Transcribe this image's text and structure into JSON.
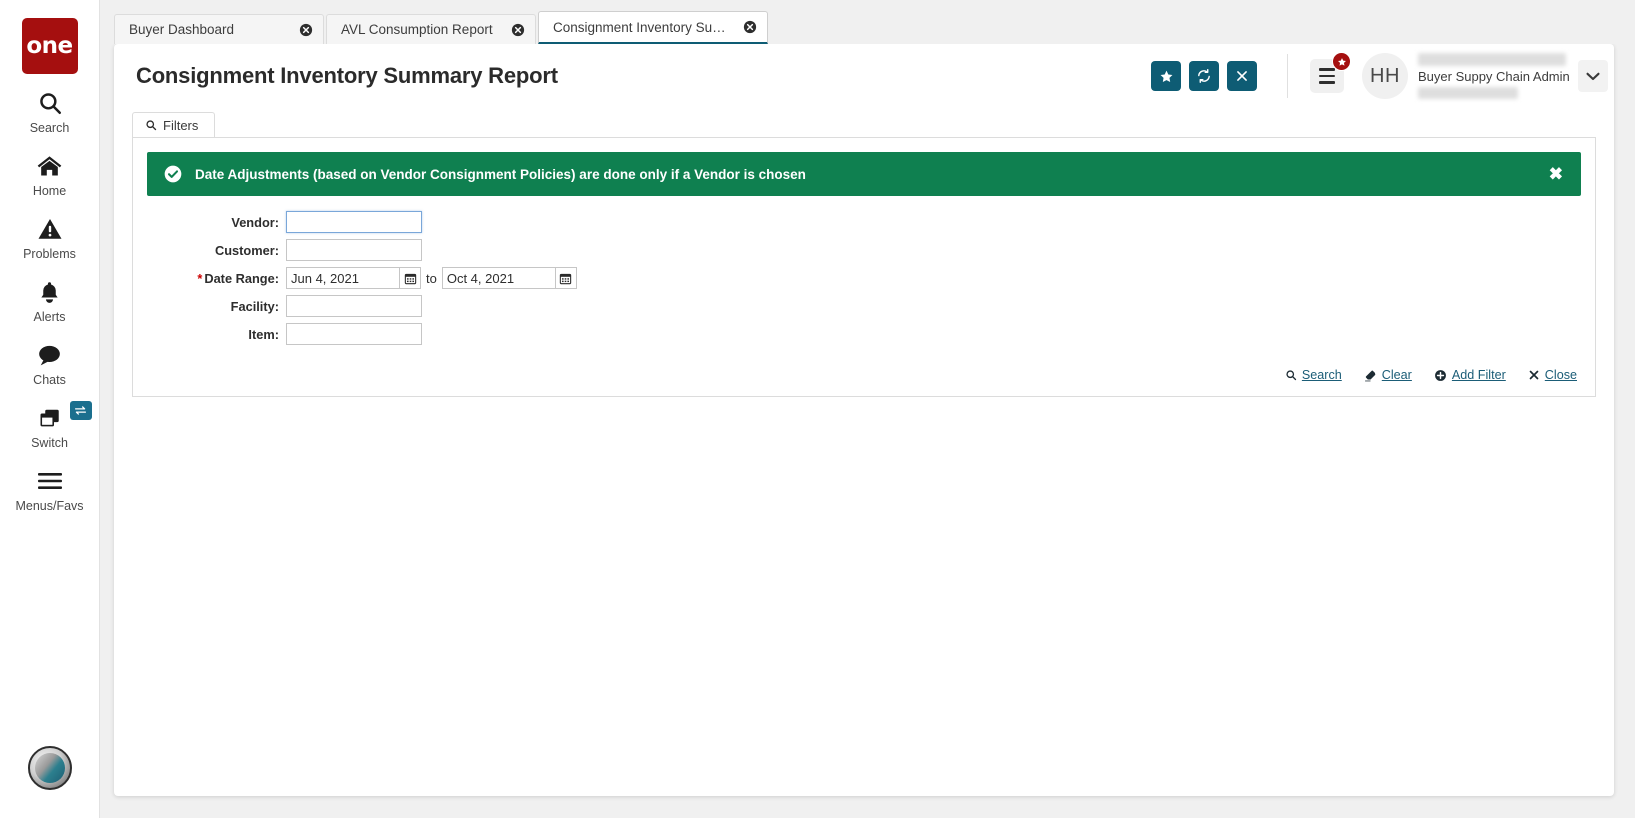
{
  "brand": {
    "logo_text": "one",
    "logo_color": "#a50f0f",
    "accent_color": "#0e5c74"
  },
  "sidebar": {
    "items": [
      {
        "label": "Search",
        "icon": "search-icon"
      },
      {
        "label": "Home",
        "icon": "home-icon"
      },
      {
        "label": "Problems",
        "icon": "warning-triangle-icon"
      },
      {
        "label": "Alerts",
        "icon": "bell-icon"
      },
      {
        "label": "Chats",
        "icon": "chat-bubble-icon"
      },
      {
        "label": "Switch",
        "icon": "windows-stack-icon",
        "badge_icon": "switch-arrows-icon"
      },
      {
        "label": "Menus/Favs",
        "icon": "hamburger-icon"
      }
    ],
    "bottom_avatar_icon": "assistant-bot-avatar"
  },
  "tabs": [
    {
      "label": "Buyer Dashboard",
      "active": false
    },
    {
      "label": "AVL Consumption Report",
      "active": false
    },
    {
      "label": "Consignment Inventory Summar...",
      "active": true
    }
  ],
  "header": {
    "title": "Consignment Inventory Summary Report",
    "buttons": [
      {
        "name": "favorite-button",
        "icon": "star-icon"
      },
      {
        "name": "refresh-button",
        "icon": "refresh-icon"
      },
      {
        "name": "close-button",
        "icon": "x-icon"
      }
    ],
    "menu_icon": "hamburger-menu-icon",
    "menu_badge_icon": "star-badge-icon",
    "avatar_initials": "HH",
    "user_role": "Buyer Suppy Chain Admin",
    "dropdown_icon": "chevron-down-icon"
  },
  "filters": {
    "tab_label": "Filters",
    "tab_icon": "search-icon",
    "alert": {
      "icon": "check-circle-icon",
      "message": "Date Adjustments (based on Vendor Consignment Policies) are done only if a Vendor is chosen",
      "close_icon": "x-icon",
      "color": "#0f8050"
    },
    "fields": [
      {
        "label": "Vendor:",
        "value": "",
        "required": false,
        "focused": true
      },
      {
        "label": "Customer:",
        "value": "",
        "required": false,
        "focused": false
      },
      {
        "label": "Facility:",
        "value": "",
        "required": false,
        "focused": false
      },
      {
        "label": "Item:",
        "value": "",
        "required": false,
        "focused": false
      }
    ],
    "date_range": {
      "label": "Date Range:",
      "required": true,
      "required_marker": "*",
      "from": "Jun 4, 2021",
      "to": "Oct 4, 2021",
      "separator": "to",
      "calendar_icon": "calendar-icon"
    },
    "actions": [
      {
        "label": "Search",
        "icon": "search-icon"
      },
      {
        "label": "Clear",
        "icon": "eraser-icon"
      },
      {
        "label": "Add Filter",
        "icon": "plus-circle-icon"
      },
      {
        "label": "Close",
        "icon": "x-icon"
      }
    ]
  }
}
